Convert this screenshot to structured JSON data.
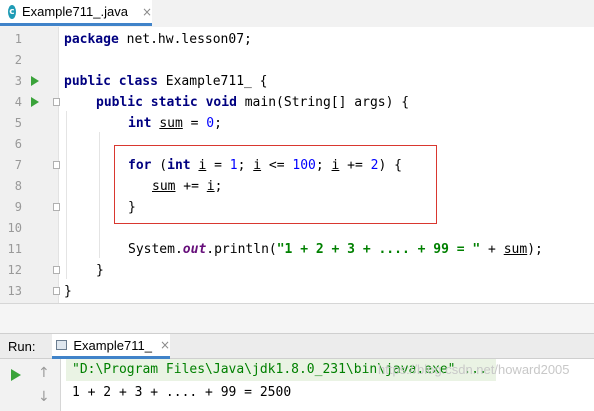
{
  "editor_tab": {
    "icon": "c",
    "label": "Example711_.java",
    "close": "×"
  },
  "lines": [
    {
      "n": "1"
    },
    {
      "n": "2"
    },
    {
      "n": "3"
    },
    {
      "n": "4"
    },
    {
      "n": "5"
    },
    {
      "n": "6"
    },
    {
      "n": "7"
    },
    {
      "n": "8"
    },
    {
      "n": "9"
    },
    {
      "n": "10"
    },
    {
      "n": "11"
    },
    {
      "n": "12"
    },
    {
      "n": "13"
    }
  ],
  "code": {
    "l1_kw": "package",
    "l1_rest": " net.hw.lesson07;",
    "l3_kw1": "public",
    "l3_kw2": "class",
    "l3_rest": " Example711_ {",
    "l4_kw1": "public",
    "l4_kw2": "static",
    "l4_kw3": "void",
    "l4_rest": " main(String[] args) {",
    "l5_kw": "int",
    "l5_var": "sum",
    "l5_eq": " = ",
    "l5_num": "0",
    "l5_end": ";",
    "l7_for": "for",
    "l7_p1": " (",
    "l7_int": "int",
    "l7_sp": " ",
    "l7_i1": "i",
    "l7_eq": " = ",
    "l7_n1": "1",
    "l7_sc1": "; ",
    "l7_i2": "i",
    "l7_le": " <= ",
    "l7_n2": "100",
    "l7_sc2": "; ",
    "l7_i3": "i",
    "l7_pe": " += ",
    "l7_n3": "2",
    "l7_end": ") {",
    "l8_sum": "sum",
    "l8_op": " += ",
    "l8_i": "i",
    "l8_end": ";",
    "l9": "}",
    "l11_pre": "System.",
    "l11_out": "out",
    "l11_mid": ".println(",
    "l11_str": "\"1 + 2 + 3 + .... + 99 = \"",
    "l11_plus": " + ",
    "l11_sum": "sum",
    "l11_end": ");",
    "l12": "}",
    "l13": "}"
  },
  "run_panel": {
    "title": "Run:",
    "tab_label": "Example711_",
    "tab_close": "×",
    "up_arrow": "↑",
    "down_arrow": "↓"
  },
  "console": {
    "command": "\"D:\\Program Files\\Java\\jdk1.8.0_231\\bin\\java.exe\" ...",
    "output": "1 + 2 + 3 + .... + 99 = 2500"
  },
  "watermark": "https://blog.csdn.net/howard2005",
  "colors": {
    "keyword": "#000080",
    "number": "#0000ff",
    "string": "#008000",
    "field": "#660e7a",
    "highlight_box": "#d9372f",
    "run_green": "#3aa33a",
    "tab_underline": "#4083c9"
  }
}
